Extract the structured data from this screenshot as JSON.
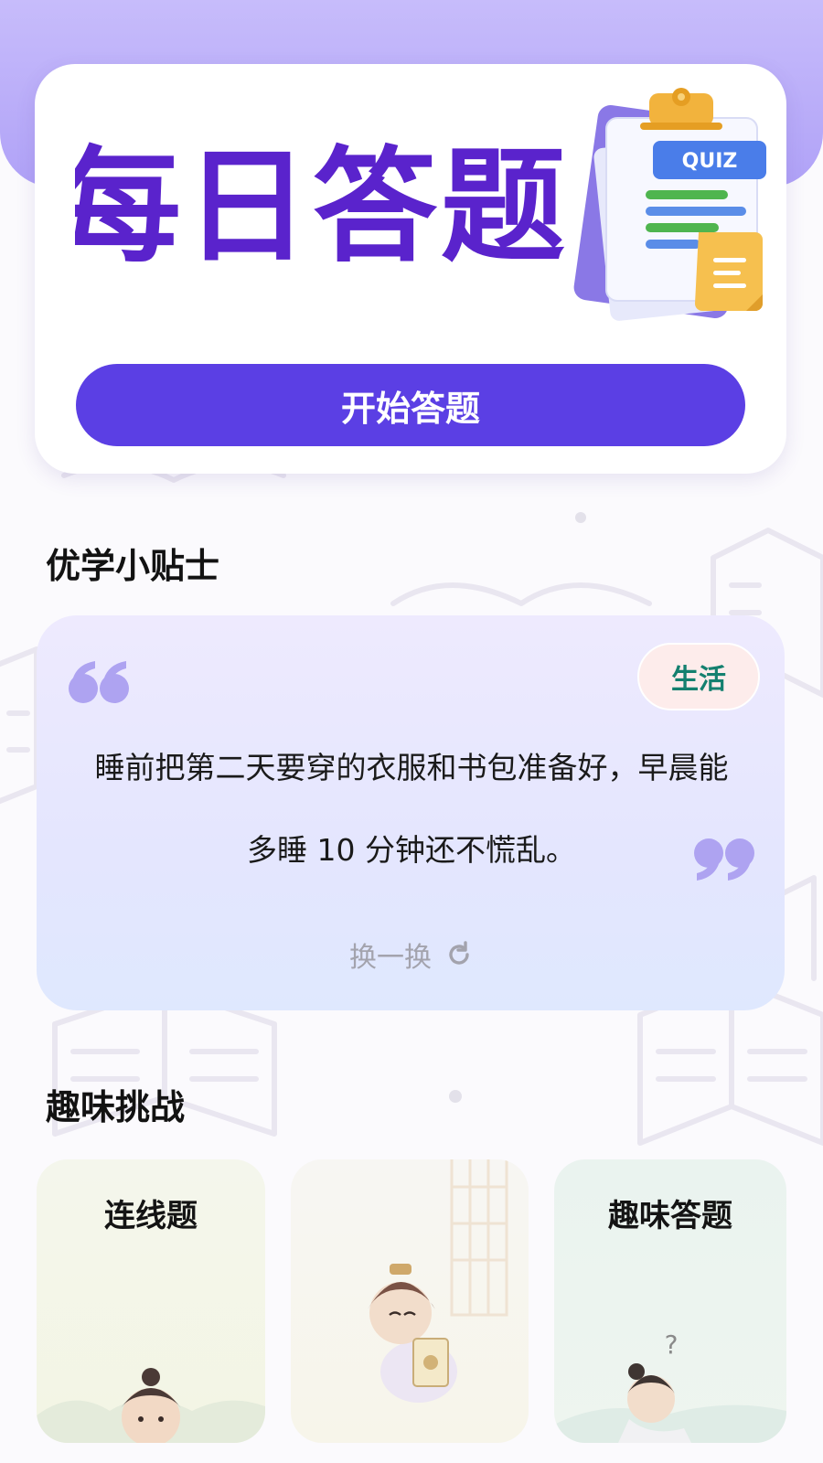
{
  "hero": {
    "title": "每日答题",
    "quiz_label": "QUIZ",
    "start_button": "开始答题"
  },
  "tips": {
    "section_title": "优学小贴士",
    "tag": "生活",
    "text": "睡前把第二天要穿的衣服和书包准备好，早晨能多睡 10 分钟还不慌乱。",
    "refresh_label": "换一换",
    "refresh_icon": "refresh-icon"
  },
  "challenges": {
    "section_title": "趣味挑战",
    "cards": [
      {
        "title": "连线题"
      },
      {
        "title": ""
      },
      {
        "title": "趣味答题"
      }
    ]
  },
  "colors": {
    "brand_purple": "#5b3fe4",
    "title_purple": "#5a23cc",
    "tag_text": "#14806f",
    "tag_bg": "#fdeceb"
  }
}
